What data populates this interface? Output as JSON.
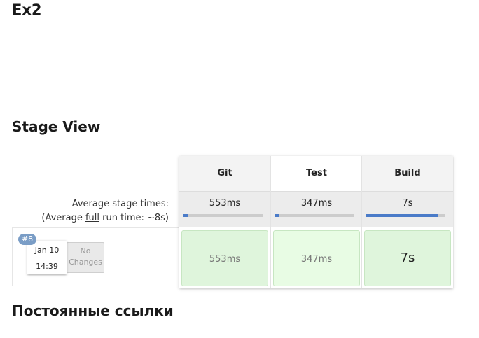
{
  "page": {
    "title": "Ex2"
  },
  "stage_view": {
    "title": "Stage View",
    "avg_label": "Average stage times:",
    "avg_full_prefix": "(Average ",
    "avg_full_link": "full",
    "avg_full_suffix": " run time: ~8s)",
    "stages": [
      {
        "name": "Git",
        "avg": "553ms",
        "progress": 0.06,
        "cell": "553ms",
        "header_bg": "#f3f3f3",
        "cell_bg": "#dff5dc"
      },
      {
        "name": "Test",
        "avg": "347ms",
        "progress": 0.06,
        "cell": "347ms",
        "header_bg": "#ffffff",
        "cell_bg": "#e8fce4"
      },
      {
        "name": "Build",
        "avg": "7s",
        "progress": 0.9,
        "cell": "7s",
        "header_bg": "#f3f3f3",
        "cell_bg": "#dff5dc"
      }
    ],
    "run": {
      "badge": "#8",
      "date": "Jan 10",
      "time": "14:39",
      "changes_line1": "No",
      "changes_line2": "Changes"
    }
  },
  "permalinks": {
    "title": "Постоянные ссылки"
  },
  "colors": {
    "progress": "#4a7bc8",
    "badge": "#7a9dc6",
    "success_cell": "#dff5dc"
  }
}
